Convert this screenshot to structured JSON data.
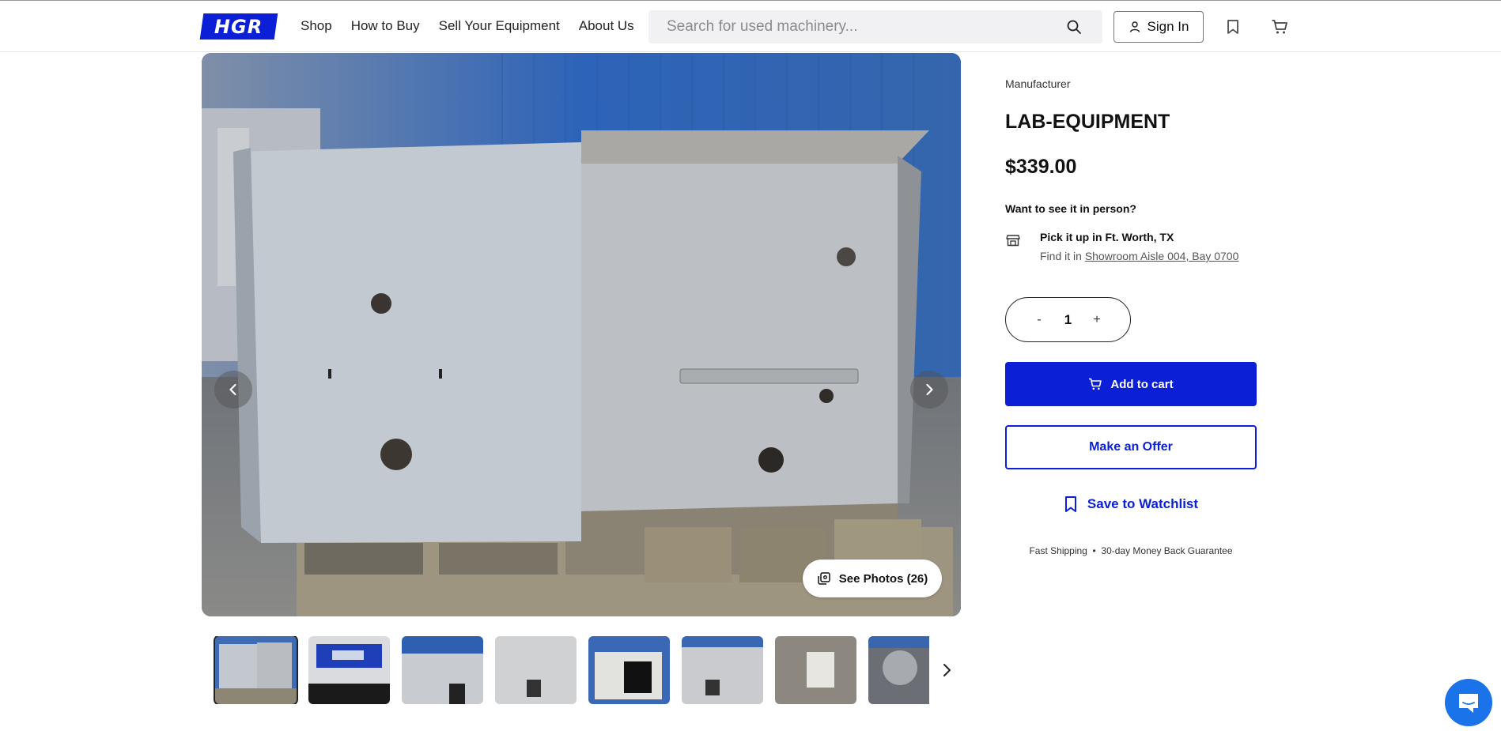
{
  "header": {
    "logo_text": "HGR",
    "nav": [
      "Shop",
      "How to Buy",
      "Sell Your Equipment",
      "About Us"
    ],
    "search_placeholder": "Search for used machinery...",
    "signin_label": "Sign In"
  },
  "gallery": {
    "see_photos_label": "See Photos (26)",
    "thumbnail_count": 8,
    "active_thumbnail": 1
  },
  "product": {
    "manufacturer_label": "Manufacturer",
    "title": "LAB-EQUIPMENT",
    "price": "$339.00",
    "see_in_person": "Want to see it in person?",
    "pickup": "Pick it up in Ft. Worth, TX",
    "find_it_prefix": "Find it in",
    "location_link": "Showroom Aisle 004, Bay 0700",
    "quantity": "1",
    "qty_minus": "-",
    "qty_plus": "+",
    "add_to_cart_label": "Add to cart",
    "make_offer_label": "Make an Offer",
    "watchlist_label": "Save to Watchlist",
    "guarantee_1": "Fast Shipping",
    "guarantee_sep": "•",
    "guarantee_2": "30-day Money Back Guarantee"
  },
  "colors": {
    "brand_blue": "#0a1fd6",
    "chat_blue": "#1a73e8"
  },
  "icons": [
    "search-icon",
    "user-icon",
    "bookmark-icon",
    "cart-icon",
    "chevron-left-icon",
    "chevron-right-icon",
    "photos-icon",
    "store-icon",
    "chat-icon"
  ]
}
